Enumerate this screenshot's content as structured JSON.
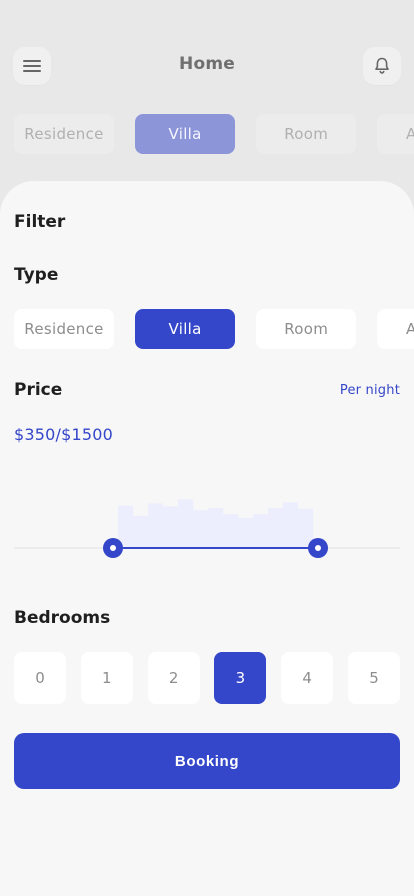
{
  "header": {
    "title": "Home",
    "menu_icon": "hamburger-menu-icon",
    "notification_icon": "bell-icon"
  },
  "background_chips": [
    {
      "label": "Residence",
      "active": false
    },
    {
      "label": "Villa",
      "active": true
    },
    {
      "label": "Room",
      "active": false
    },
    {
      "label": "Apart",
      "active": false
    }
  ],
  "filter": {
    "title": "Filter",
    "type": {
      "title": "Type",
      "chips": [
        {
          "label": "Residence",
          "active": false
        },
        {
          "label": "Villa",
          "active": true
        },
        {
          "label": "Room",
          "active": false
        },
        {
          "label": "Apart",
          "active": false
        }
      ]
    },
    "price": {
      "title": "Price",
      "unit": "Per night",
      "range_text": "$350/$1500"
    },
    "bedrooms": {
      "title": "Bedrooms",
      "options": [
        "0",
        "1",
        "2",
        "3",
        "4",
        "5"
      ],
      "selected": "3"
    },
    "booking_label": "Booking"
  },
  "chart_data": {
    "type": "bar",
    "values": [
      0.55,
      0.42,
      0.58,
      0.54,
      0.63,
      0.49,
      0.52,
      0.44,
      0.39,
      0.44,
      0.52,
      0.59,
      0.51
    ],
    "selected_range": [
      0.0,
      1.0
    ],
    "handles": [
      0.0,
      1.0
    ]
  },
  "colors": {
    "accent": "#3446c9",
    "accent_soft": "#8c95d8",
    "histogram_fill": "#eceefd"
  }
}
